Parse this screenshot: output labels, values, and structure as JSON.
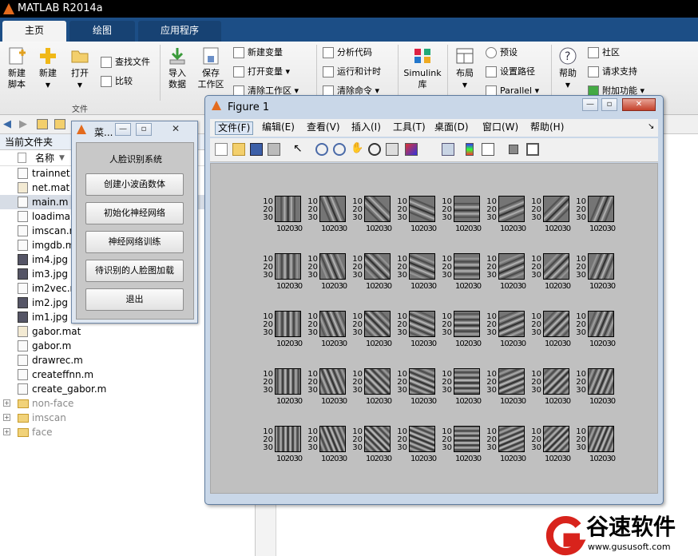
{
  "app": {
    "title": "MATLAB R2014a"
  },
  "tabs": [
    {
      "label": "主页"
    },
    {
      "label": "绘图"
    },
    {
      "label": "应用程序"
    }
  ],
  "ribbon": {
    "new_script": "新建\n脚本",
    "new": "新建",
    "open": "打开",
    "find_files": "查找文件",
    "compare": "比较",
    "import_data": "导入\n数据",
    "save_workspace": "保存\n工作区",
    "new_variable": "新建变量",
    "open_variable": "打开变量",
    "clear_workspace": "清除工作区",
    "analyze_code": "分析代码",
    "run_and_time": "运行和计时",
    "clear_commands": "清除命令",
    "simulink": "Simulink\n库",
    "layout": "布局",
    "preferences": "预设",
    "set_path": "设置路径",
    "parallel": "Parallel",
    "help": "帮助",
    "community": "社区",
    "request_support": "请求支持",
    "addons": "附加功能",
    "group_file": "文件"
  },
  "file_panel": {
    "header": "当前文件夹",
    "column_name": "名称",
    "files": [
      {
        "name": "trainnet.m",
        "kind": "m",
        "dim": false
      },
      {
        "name": "net.mat",
        "kind": "mat",
        "dim": false
      },
      {
        "name": "main.m",
        "kind": "m",
        "dim": false
      },
      {
        "name": "loadima",
        "kind": "m",
        "dim": false
      },
      {
        "name": "imscan.m",
        "kind": "m",
        "dim": false
      },
      {
        "name": "imgdb.m",
        "kind": "m",
        "dim": false
      },
      {
        "name": "im4.jpg",
        "kind": "img",
        "dim": false
      },
      {
        "name": "im3.jpg",
        "kind": "img",
        "dim": false
      },
      {
        "name": "im2vec.m",
        "kind": "m",
        "dim": false
      },
      {
        "name": "im2.jpg",
        "kind": "img",
        "dim": false
      },
      {
        "name": "im1.jpg",
        "kind": "img",
        "dim": false
      },
      {
        "name": "gabor.mat",
        "kind": "mat",
        "dim": false
      },
      {
        "name": "gabor.m",
        "kind": "m",
        "dim": false
      },
      {
        "name": "drawrec.m",
        "kind": "m",
        "dim": false
      },
      {
        "name": "createffnn.m",
        "kind": "m",
        "dim": false
      },
      {
        "name": "create_gabor.m",
        "kind": "m",
        "dim": false
      },
      {
        "name": "non-face",
        "kind": "folder",
        "dim": true
      },
      {
        "name": "imscan",
        "kind": "folder",
        "dim": true
      },
      {
        "name": "face",
        "kind": "folder",
        "dim": true
      }
    ]
  },
  "menu_window": {
    "title": "菜...",
    "system_title": "人脸识别系统",
    "buttons": [
      "创建小波函数体",
      "初始化神经网络",
      "神经网络训练",
      "待识别的人脸图加载",
      "退出"
    ]
  },
  "figure_window": {
    "title": "Figure 1",
    "menus": [
      "文件(F)",
      "编辑(E)",
      "查看(V)",
      "插入(I)",
      "工具(T)",
      "桌面(D)",
      "窗口(W)",
      "帮助(H)"
    ],
    "y_ticks": [
      "10",
      "20",
      "30"
    ],
    "x_ticks": "102030"
  },
  "gabor_grid": {
    "rows": 5,
    "cols": 8,
    "orientations_deg": [
      0,
      22.5,
      45,
      67.5,
      90,
      112.5,
      135,
      157.5
    ],
    "frequencies": [
      0.6,
      0.45,
      0.33,
      0.25,
      0.18
    ]
  },
  "watermark": {
    "brand": "谷速软件",
    "url": "www.gususoft.com",
    "brand_color": "#d8231c"
  }
}
